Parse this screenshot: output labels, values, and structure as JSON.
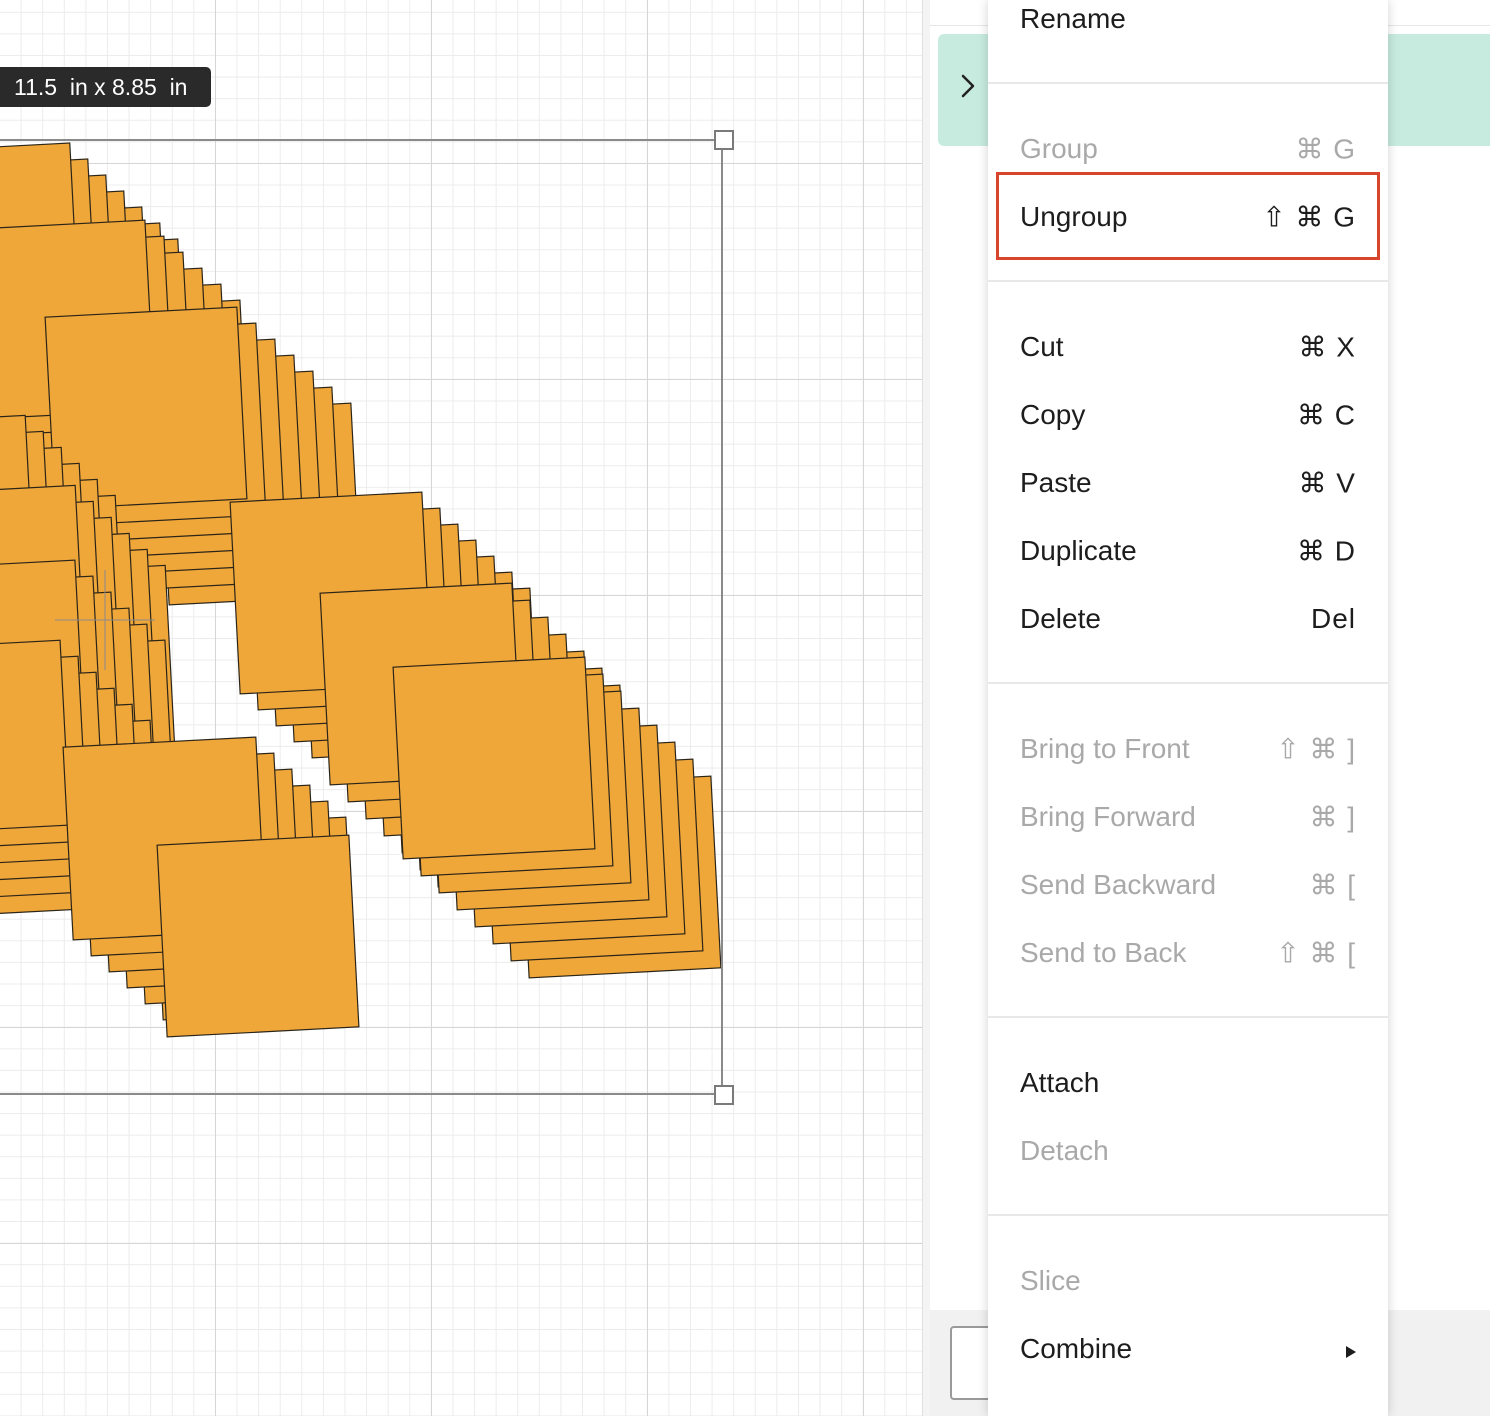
{
  "canvas": {
    "dimension_label": "11.5  in x 8.85  in",
    "shape_fill": "#f0a73a",
    "shape_stroke": "#2b2418"
  },
  "menu": {
    "items": [
      {
        "id": "rename",
        "label": "Rename",
        "shortcut": "",
        "enabled": true
      },
      {
        "id": "group",
        "label": "Group",
        "shortcut": "⌘ G",
        "enabled": false
      },
      {
        "id": "ungroup",
        "label": "Ungroup",
        "shortcut": "⇧ ⌘ G",
        "enabled": true,
        "highlighted": true
      },
      {
        "id": "cut",
        "label": "Cut",
        "shortcut": "⌘ X",
        "enabled": true
      },
      {
        "id": "copy",
        "label": "Copy",
        "shortcut": "⌘ C",
        "enabled": true
      },
      {
        "id": "paste",
        "label": "Paste",
        "shortcut": "⌘ V",
        "enabled": true
      },
      {
        "id": "duplicate",
        "label": "Duplicate",
        "shortcut": "⌘ D",
        "enabled": true
      },
      {
        "id": "delete",
        "label": "Delete",
        "shortcut": "Del",
        "enabled": true
      },
      {
        "id": "bring-to-front",
        "label": "Bring to Front",
        "shortcut": "⇧ ⌘ ]",
        "enabled": false
      },
      {
        "id": "bring-forward",
        "label": "Bring Forward",
        "shortcut": "⌘ ]",
        "enabled": false
      },
      {
        "id": "send-backward",
        "label": "Send Backward",
        "shortcut": "⌘ [",
        "enabled": false
      },
      {
        "id": "send-to-back",
        "label": "Send to Back",
        "shortcut": "⇧ ⌘ [",
        "enabled": false
      },
      {
        "id": "attach",
        "label": "Attach",
        "shortcut": "",
        "enabled": true
      },
      {
        "id": "detach",
        "label": "Detach",
        "shortcut": "",
        "enabled": false
      },
      {
        "id": "slice",
        "label": "Slice",
        "shortcut": "",
        "enabled": false
      },
      {
        "id": "combine",
        "label": "Combine",
        "shortcut": "submenu-arrow",
        "enabled": true
      }
    ],
    "highlight_color": "#d9452b"
  },
  "panel": {
    "layer_row_color": "#c7ebdf",
    "layer_row_icon": "chevron-right-icon"
  }
}
